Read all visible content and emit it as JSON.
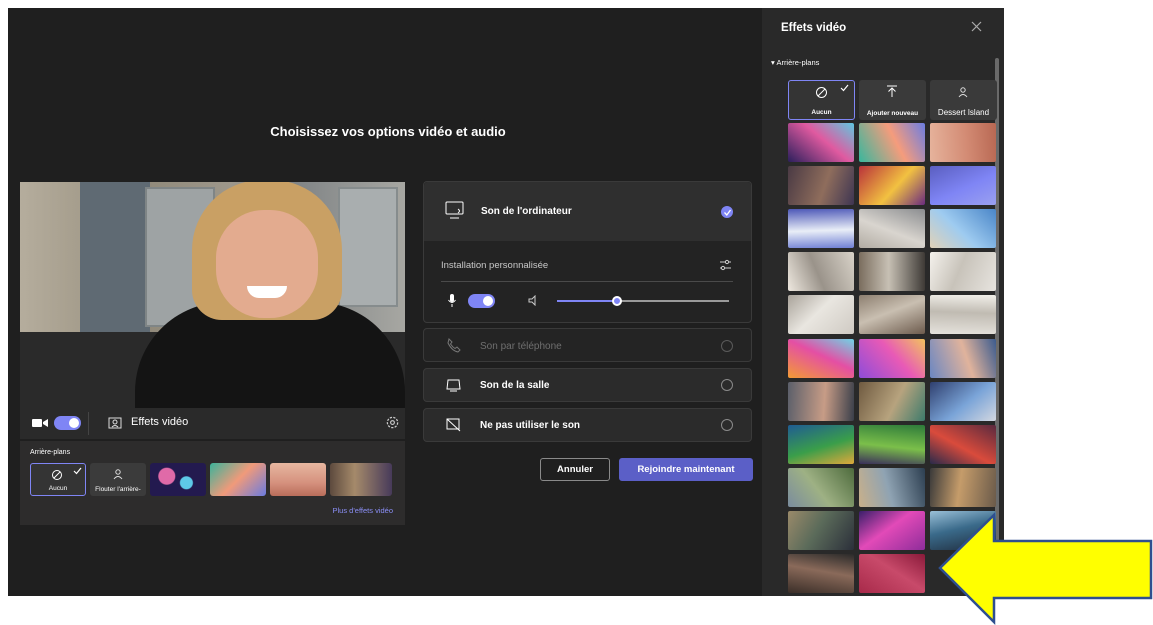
{
  "header": {
    "title": "Choisissez vos options vidéo et audio"
  },
  "preview": {
    "effects_label": "Effets vidéo",
    "backgrounds_label": "Arrière-plans",
    "tiles": [
      "Aucun",
      "Flouter l'arrière-"
    ],
    "more_effects": "Plus d'effets vidéo"
  },
  "audio": {
    "computer": "Son de l'ordinateur",
    "custom": "Installation personnalisée",
    "phone": "Son par téléphone",
    "room": "Son de la salle",
    "none": "Ne pas utiliser le son",
    "speaker_volume_fraction": 0.35
  },
  "buttons": {
    "cancel": "Annuler",
    "join": "Rejoindre maintenant"
  },
  "fx_panel": {
    "title": "Effets vidéo",
    "section": "Arrière-plans",
    "top_tiles": [
      "Aucun",
      "Ajouter nouveau",
      "Dessert Island"
    ]
  },
  "colors": {
    "accent": "#7f85f5",
    "join": "#5b5fc7",
    "arrow_fill": "#ffff00",
    "arrow_stroke": "#2f4f8f"
  }
}
